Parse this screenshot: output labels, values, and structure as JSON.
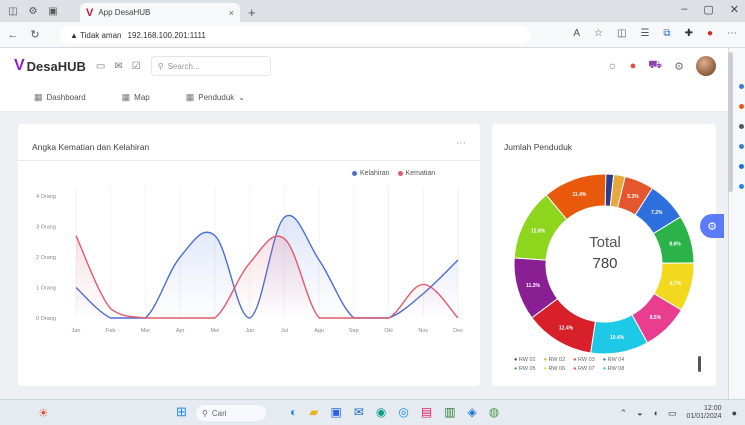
{
  "browser": {
    "tab_title": "App DesaHUB",
    "tab_close": "×",
    "new_tab": "+",
    "url_warning": "▲ Tidak aman",
    "url": "192.168.100.201:1111",
    "window_controls": [
      "–",
      "▢",
      "✕"
    ],
    "nav_icons": [
      "back-icon",
      "refresh-icon"
    ]
  },
  "header": {
    "logo_mark": "V",
    "app_name": "DesaHUB",
    "search_placeholder": "Search..."
  },
  "nav": {
    "items": [
      {
        "label": "Dashboard",
        "icon": "grid-icon"
      },
      {
        "label": "Map",
        "icon": "map-icon"
      },
      {
        "label": "Penduduk",
        "icon": "users-icon",
        "dropdown": "⌄"
      }
    ]
  },
  "line_card": {
    "title": "Angka Kematian dan Kelahiran",
    "more": "⋯",
    "legend": [
      {
        "name": "Kelahiran",
        "color": "#4a6fd6"
      },
      {
        "name": "Kematian",
        "color": "#e05b6e"
      }
    ]
  },
  "donut_card": {
    "title": "Jumlah Penduduk",
    "center_label": "Total",
    "center_value": "780",
    "legend_rows": [
      [
        "RW 01",
        "RW 02",
        "RW 03",
        "RW 04"
      ],
      [
        "RW 05",
        "RW 06",
        "RW 07",
        "RW 08"
      ]
    ]
  },
  "taskbar": {
    "search": "Cari",
    "time": "12:00",
    "date": "01/01/2024"
  },
  "colors": {
    "brand": "#8e1fd1",
    "kelahiran": "#4a6fd6",
    "kematian": "#e05b6e",
    "fab": "#5b7cfa"
  },
  "chart_data": [
    {
      "type": "line",
      "title": "Angka Kematian dan Kelahiran",
      "categories": [
        "Jan",
        "Feb",
        "Mar",
        "Apr",
        "Mei",
        "Jun",
        "Jul",
        "Agu",
        "Sep",
        "Okt",
        "Nov",
        "Des"
      ],
      "ytick_labels": [
        "0 Orang",
        "1 Orang",
        "2 Orang",
        "3 Orang",
        "4 Orang"
      ],
      "ylim": [
        0,
        4
      ],
      "series": [
        {
          "name": "Kelahiran",
          "color": "#4a6fd6",
          "values": [
            1,
            0,
            0,
            2,
            2.7,
            0,
            3.3,
            1.9,
            0,
            0,
            0.8,
            1.9
          ]
        },
        {
          "name": "Kematian",
          "color": "#e05b6e",
          "values": [
            2.7,
            0.3,
            0,
            0,
            0,
            1.8,
            2.6,
            0,
            0,
            0,
            1.1,
            0
          ]
        }
      ],
      "legend_position": "top-right",
      "grid": false
    },
    {
      "type": "pie",
      "title": "Jumlah Penduduk",
      "donut": true,
      "center_text": "Total",
      "total": 780,
      "slices": [
        {
          "value": 11,
          "color": "#2f3b8f"
        },
        {
          "value": 16,
          "color": "#e8a83c"
        },
        {
          "value": 41,
          "color": "#e4572e"
        },
        {
          "value": 56,
          "color": "#2d6fdc"
        },
        {
          "value": 67,
          "color": "#2bb34a"
        },
        {
          "value": 68,
          "color": "#f2d91d"
        },
        {
          "value": 66,
          "color": "#e93d8f"
        },
        {
          "value": 81,
          "color": "#1ec9e8"
        },
        {
          "value": 97,
          "color": "#d8202b"
        },
        {
          "value": 88,
          "color": "#8a1f93"
        },
        {
          "value": 100,
          "color": "#8ed61e"
        },
        {
          "value": 89,
          "color": "#e8590c"
        }
      ]
    }
  ]
}
